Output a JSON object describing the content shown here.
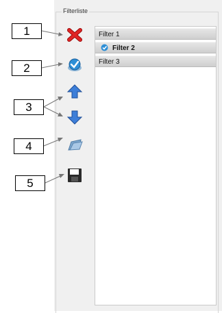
{
  "group": {
    "title": "Filterliste"
  },
  "callouts": [
    "1",
    "2",
    "3",
    "4",
    "5"
  ],
  "toolbar": [
    {
      "icon": "delete-icon"
    },
    {
      "icon": "apply-filter-icon"
    },
    {
      "icon": "move-up-icon"
    },
    {
      "icon": "move-down-icon"
    },
    {
      "icon": "open-folder-icon"
    },
    {
      "icon": "save-icon"
    }
  ],
  "filters": [
    {
      "label": "Filter 1",
      "active": false
    },
    {
      "label": "Filter 2",
      "active": true
    },
    {
      "label": "Filter 3",
      "active": false
    }
  ],
  "colors": {
    "delete": "#d81818",
    "arrow": "#3d7ed8",
    "check": "#2e8fd6"
  }
}
